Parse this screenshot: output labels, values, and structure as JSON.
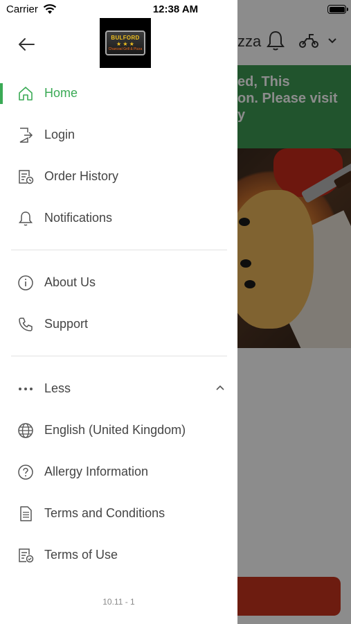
{
  "status_bar": {
    "carrier": "Carrier",
    "time": "12:38 AM"
  },
  "brand": {
    "logo_name": "BULFORD",
    "logo_stars": "★ ★ ★",
    "logo_sub": "Charcoal Grill & Pizza"
  },
  "menu": {
    "home": "Home",
    "login": "Login",
    "order_history": "Order History",
    "notifications": "Notifications",
    "about_us": "About Us",
    "support": "Support",
    "less": "Less",
    "language": "English (United Kingdom)",
    "allergy": "Allergy Information",
    "terms_conditions": "Terms and Conditions",
    "terms_use": "Terms of Use"
  },
  "version": "10.11 - 1",
  "background": {
    "title_fragment": "zza",
    "banner_line1": "ed, This",
    "banner_line2": "on. Please visit",
    "banner_line3": "y"
  },
  "colors": {
    "accent": "#3aaa55",
    "banner": "#3d9a53",
    "order_button": "#c6331e"
  }
}
